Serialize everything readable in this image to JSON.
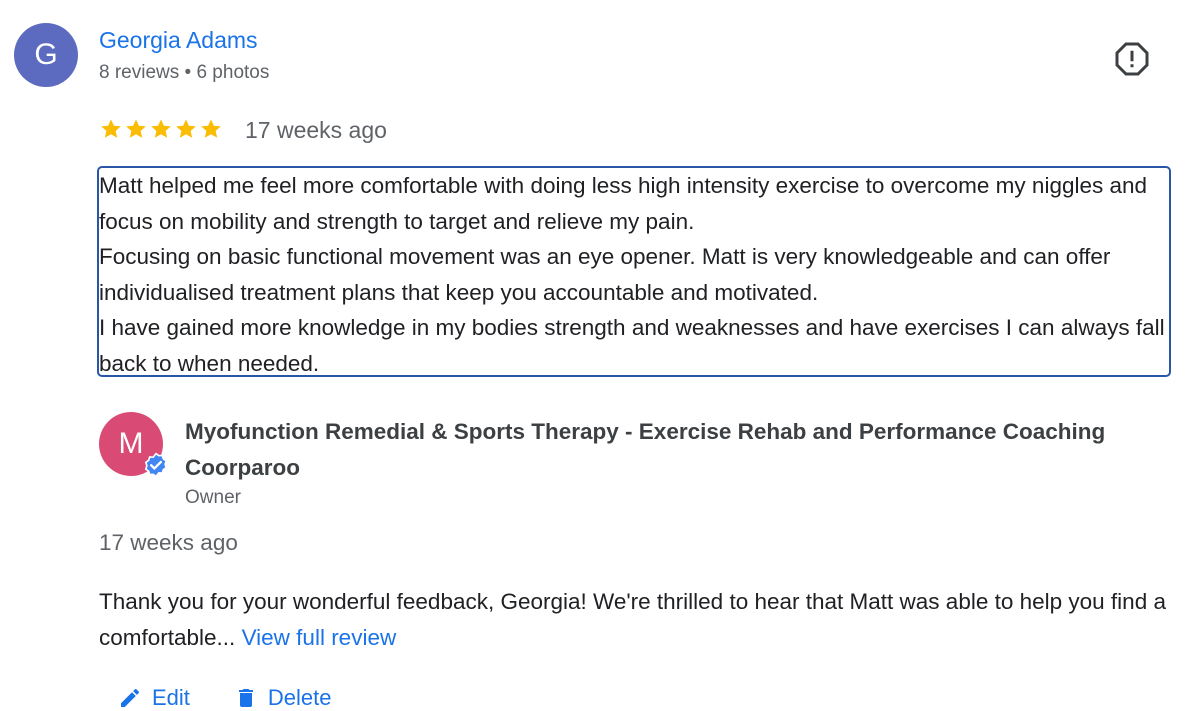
{
  "reviewer": {
    "initial": "G",
    "name": "Georgia Adams",
    "meta": "8 reviews • 6 photos"
  },
  "review": {
    "rating": 5,
    "time": "17 weeks ago",
    "text": "Matt helped me feel more comfortable with doing less high intensity exercise to overcome my niggles and focus on mobility and strength to target and relieve my pain.\nFocusing on basic functional movement was an eye opener. Matt is very knowledgeable and can offer individualised treatment plans that keep you accountable and motivated.\nI have gained more knowledge in my bodies strength and weaknesses and have exercises I can always fall back to when needed."
  },
  "owner_reply": {
    "initial": "M",
    "name": "Myofunction Remedial & Sports Therapy - Exercise Rehab and Performance Coaching Coorparoo",
    "role": "Owner",
    "time": "17 weeks ago",
    "text": "Thank you for your wonderful feedback, Georgia! We're thrilled to hear that Matt was able to help you find a comfortable... ",
    "view_full_label": "View full review"
  },
  "actions": {
    "edit_label": "Edit",
    "delete_label": "Delete"
  },
  "colors": {
    "reviewer_avatar": "#5c6bc0",
    "owner_avatar": "#d94b74",
    "link": "#1a73e8",
    "star": "#fbbc04",
    "focus_border": "#2a56a8"
  },
  "icons": [
    "report-icon",
    "star-icon",
    "verified-icon",
    "edit-pencil-icon",
    "delete-trash-icon"
  ]
}
